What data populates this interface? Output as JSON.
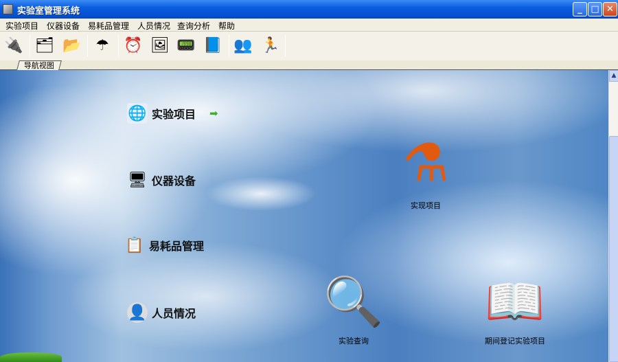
{
  "window": {
    "title": "实验室管理系统",
    "minimize": "_",
    "maximize": "□",
    "close": "✕"
  },
  "menu": [
    "实验项目",
    "仪器设备",
    "易耗品管理",
    "人员情况",
    "查询分析",
    "帮助"
  ],
  "toolbar": [
    {
      "icon": "connect-icon",
      "glyph": "🔌"
    },
    {
      "icon": "folder-archive-icon",
      "glyph": "🗂"
    },
    {
      "icon": "folder-move-icon",
      "glyph": "📂"
    },
    {
      "icon": "umbrella-icon",
      "glyph": "☂"
    },
    {
      "icon": "alarm-clock-icon",
      "glyph": "⏰"
    },
    {
      "icon": "picture-icon",
      "glyph": "🖼"
    },
    {
      "icon": "pda-icon",
      "glyph": "📟"
    },
    {
      "icon": "help-book-icon",
      "glyph": "📘"
    },
    {
      "icon": "users-icon",
      "glyph": "👥"
    },
    {
      "icon": "runner-icon",
      "glyph": "🏃"
    }
  ],
  "tab": "导航视图",
  "nav": [
    {
      "label": "实验项目",
      "icon": "🌐"
    },
    {
      "label": "仪器设备",
      "icon": "🖥"
    },
    {
      "label": "易耗品管理",
      "icon": "📋"
    },
    {
      "label": "人员情况",
      "icon": "👤"
    }
  ],
  "arrow": "➡",
  "actions": [
    {
      "label": "实现项目",
      "glyph": "⚗"
    },
    {
      "label": "实验查询",
      "glyph": "🔍"
    },
    {
      "label": "期间登记实验项目",
      "glyph": "📖"
    }
  ]
}
